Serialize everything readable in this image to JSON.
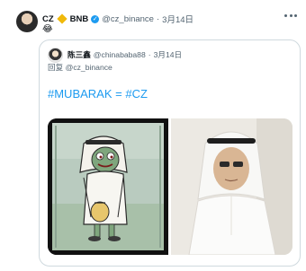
{
  "tweet": {
    "author_name": "CZ",
    "badge_text": "BNB",
    "verified_mark": "✓",
    "handle": "@cz_binance",
    "separator": "·",
    "date": "3月14日",
    "emoji": "😂",
    "more_icon": "more-icon"
  },
  "quoted": {
    "author_name": "陈三鑫",
    "handle": "@chinababa88",
    "separator": "·",
    "date": "3月14日",
    "reply_prefix": "回复",
    "reply_to": "@cz_binance",
    "hashtag_1": "#MUBARAK",
    "equals": "=",
    "hashtag_2": "#CZ"
  },
  "colors": {
    "link": "#1d9bf0",
    "muted": "#536471",
    "bnb_diamond": "#f0b90b",
    "border": "#cfd9de"
  }
}
